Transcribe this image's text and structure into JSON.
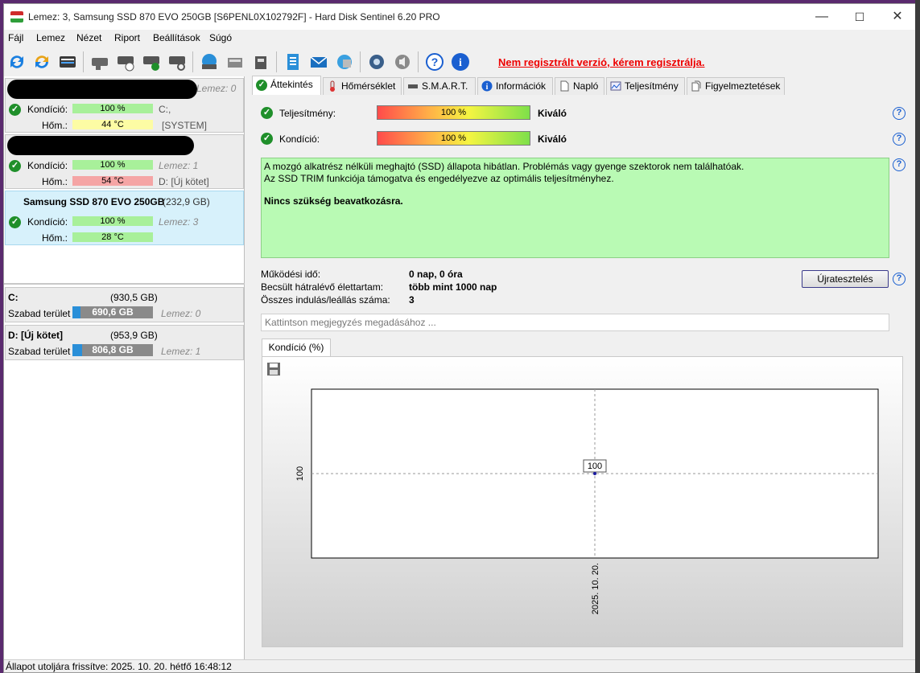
{
  "window": {
    "title": "Lemez: 3, Samsung SSD 870 EVO 250GB [S6PENL0X102792F]  -  Hard Disk Sentinel 6.20 PRO",
    "min": "—",
    "max": "☐",
    "close": "✕"
  },
  "menu": [
    "Fájl",
    "Lemez",
    "Nézet",
    "Riport",
    "Beállítások",
    "Súgó"
  ],
  "registration_warning": "Nem regisztrált verzió, kérem regisztrálja.",
  "disks": [
    {
      "name": "",
      "index_label": "Lemez: 0",
      "cond_label": "Kondíció:",
      "cond": "100 %",
      "drive": "C:,",
      "temp_label": "Hőm.:",
      "temp": "44 °C",
      "extra": "[SYSTEM]"
    },
    {
      "name": "",
      "index_label": "",
      "cond_label": "Kondíció:",
      "cond": "100 %",
      "drive": "Lemez: 1",
      "temp_label": "Hőm.:",
      "temp": "54 °C",
      "extra": "D: [Új kötet]"
    },
    {
      "name": "Samsung SSD 870 EVO 250GB",
      "size": "(232,9 GB)",
      "cond_label": "Kondíció:",
      "cond": "100 %",
      "drive": "Lemez: 3",
      "temp_label": "Hőm.:",
      "temp": "28 °C"
    }
  ],
  "volumes": [
    {
      "name": "C:",
      "size": "(930,5 GB)",
      "free_label": "Szabad terület",
      "free": "690,6 GB",
      "free_fraction": 0.74,
      "disk": "Lemez: 0"
    },
    {
      "name": "D: [Új kötet]",
      "size": "(953,9 GB)",
      "free_label": "Szabad terület",
      "free": "806,8 GB",
      "free_fraction": 0.85,
      "disk": "Lemez: 1"
    }
  ],
  "tabs": [
    "Áttekintés",
    "Hőmérséklet",
    "S.M.A.R.T.",
    "Információk",
    "Napló",
    "Teljesítmény",
    "Figyelmeztetések"
  ],
  "overview": {
    "performance_label": "Teljesítmény:",
    "performance_value": "100 %",
    "performance_fraction": 1.0,
    "performance_rating": "Kiváló",
    "condition_label": "Kondíció:",
    "condition_value": "100 %",
    "condition_fraction": 1.0,
    "condition_rating": "Kiváló",
    "status_line1": "A mozgó alkatrész nélküli meghajtó (SSD) állapota hibátlan. Problémás vagy gyenge szektorok nem találhatóak.",
    "status_line2": "Az SSD TRIM funkciója támogatva és engedélyezve az optimális teljesítményhez.",
    "status_line3": "Nincs szükség beavatkozásra.",
    "uptime_label": "Működési idő:",
    "uptime": "0 nap, 0 óra",
    "life_label": "Becsült hátralévő élettartam:",
    "life": "több mint 1000 nap",
    "starts_label": "Összes indulás/leállás száma:",
    "starts": "3",
    "retest_button": "Újratesztelés",
    "note_placeholder": "Kattintson megjegyzés megadásához ..."
  },
  "chart_data": {
    "type": "line",
    "tab_label": "Kondíció  (%)",
    "x": [
      "2025. 10. 20."
    ],
    "series": [
      {
        "values": [
          100
        ]
      }
    ],
    "point_label": "100",
    "ytick": "100",
    "grid": true
  },
  "statusbar": "Állapot utoljára frissítve: 2025. 10. 20. hétfő 16:48:12"
}
